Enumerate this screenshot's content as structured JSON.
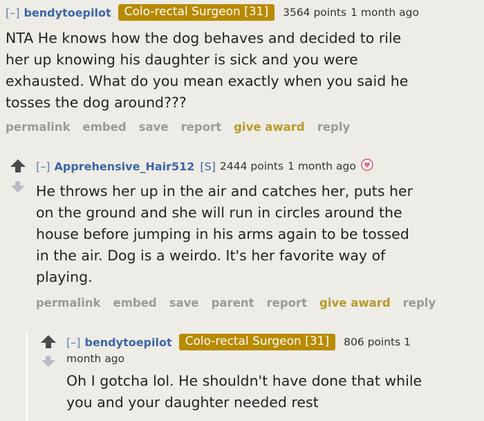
{
  "comments": [
    {
      "collapse": "[–]",
      "author": "bendytoepilot",
      "flair": "Colo-rectal Surgeon [31]",
      "score": "3564 points",
      "time": "1 month ago",
      "body": [
        "NTA He knows how the dog behaves and decided to rile",
        "her up knowing his daughter is sick and you were",
        "exhausted. What do you mean exactly when you said he",
        "tosses the dog around???"
      ],
      "buttons": [
        "permalink",
        "embed",
        "save",
        "report",
        "give award",
        "reply"
      ]
    },
    {
      "collapse": "[–]",
      "author": "Apprehensive_Hair512",
      "submitter": "[S]",
      "score": "2444 points",
      "time": "1 month ago",
      "award_icon": "heart-award-icon",
      "body": [
        "He throws her up in the air and catches her, puts her",
        "on the ground and she will run in circles around the",
        "house before jumping in his arms again to be tossed",
        "in the air. Dog is a weirdo. It's her favorite way of",
        "playing."
      ],
      "buttons": [
        "permalink",
        "embed",
        "save",
        "parent",
        "report",
        "give award",
        "reply"
      ]
    },
    {
      "collapse": "[–]",
      "author": "bendytoepilot",
      "flair": "Colo-rectal Surgeon [31]",
      "score": "806 points 1",
      "time": "month ago",
      "body": [
        "Oh I gotcha lol. He shouldn't have done that while",
        "you and your daughter needed rest"
      ]
    }
  ],
  "colors": {
    "flair_bg": "#b88a00",
    "author": "#3a66a8",
    "award_button": "#b69a2a",
    "background": "#eeece6"
  }
}
